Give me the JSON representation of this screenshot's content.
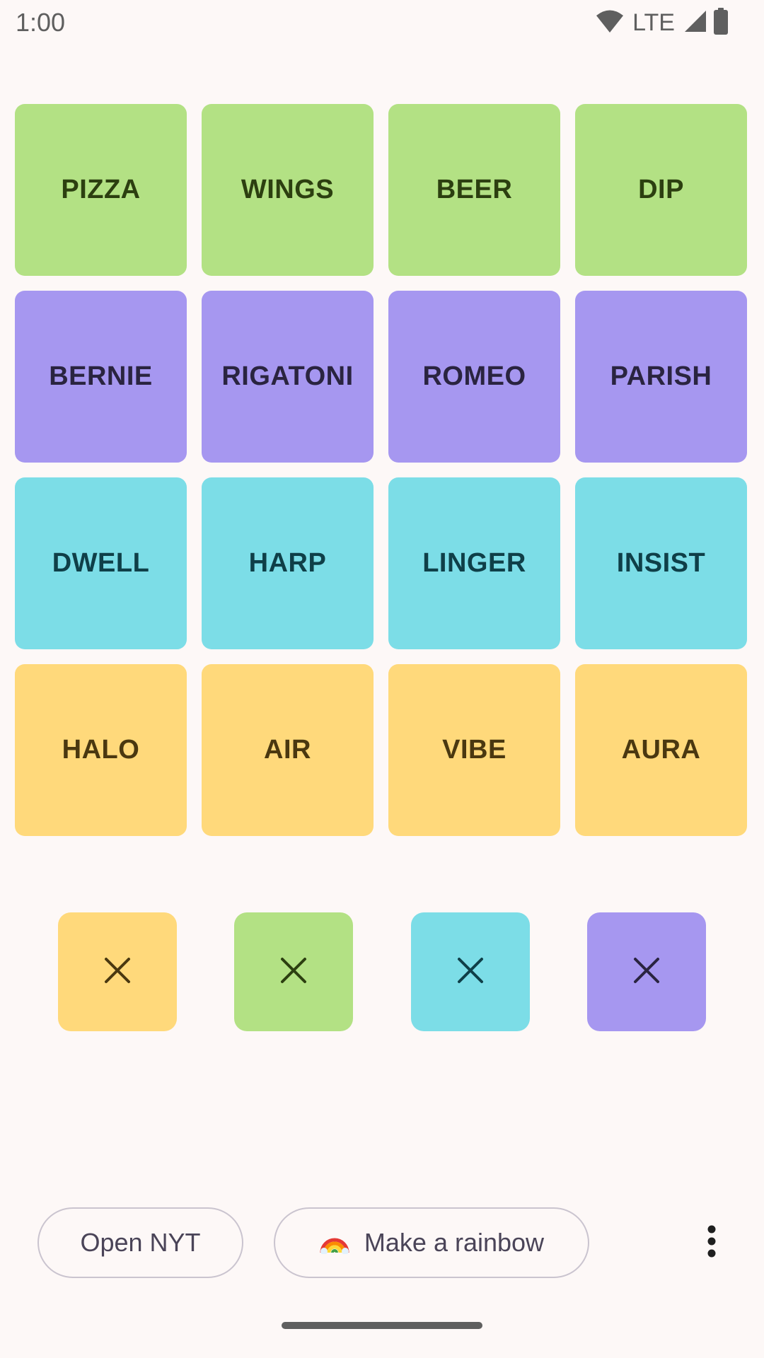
{
  "status_bar": {
    "time": "1:00",
    "network": "LTE"
  },
  "colors": {
    "green": "#b3e184",
    "purple": "#a697f0",
    "cyan": "#7cdde7",
    "yellow": "#ffd97b",
    "green_text": "#2c3f10",
    "purple_text": "#2a2440",
    "cyan_text": "#0f3f48",
    "yellow_text": "#4a3810"
  },
  "tiles": [
    {
      "label": "PIZZA",
      "color": "green"
    },
    {
      "label": "WINGS",
      "color": "green"
    },
    {
      "label": "BEER",
      "color": "green"
    },
    {
      "label": "DIP",
      "color": "green"
    },
    {
      "label": "BERNIE",
      "color": "purple"
    },
    {
      "label": "RIGATONI",
      "color": "purple"
    },
    {
      "label": "ROMEO",
      "color": "purple"
    },
    {
      "label": "PARISH",
      "color": "purple"
    },
    {
      "label": "DWELL",
      "color": "cyan"
    },
    {
      "label": "HARP",
      "color": "cyan"
    },
    {
      "label": "LINGER",
      "color": "cyan"
    },
    {
      "label": "INSIST",
      "color": "cyan"
    },
    {
      "label": "HALO",
      "color": "yellow"
    },
    {
      "label": "AIR",
      "color": "yellow"
    },
    {
      "label": "VIBE",
      "color": "yellow"
    },
    {
      "label": "AURA",
      "color": "yellow"
    }
  ],
  "group_buttons": [
    {
      "color": "yellow",
      "icon": "close-icon"
    },
    {
      "color": "green",
      "icon": "close-icon"
    },
    {
      "color": "cyan",
      "icon": "close-icon"
    },
    {
      "color": "purple",
      "icon": "close-icon"
    }
  ],
  "actions": {
    "open_nyt": "Open NYT",
    "make_rainbow": "Make a rainbow",
    "rainbow_icon": "rainbow-icon",
    "more_icon": "more-vertical-icon"
  }
}
